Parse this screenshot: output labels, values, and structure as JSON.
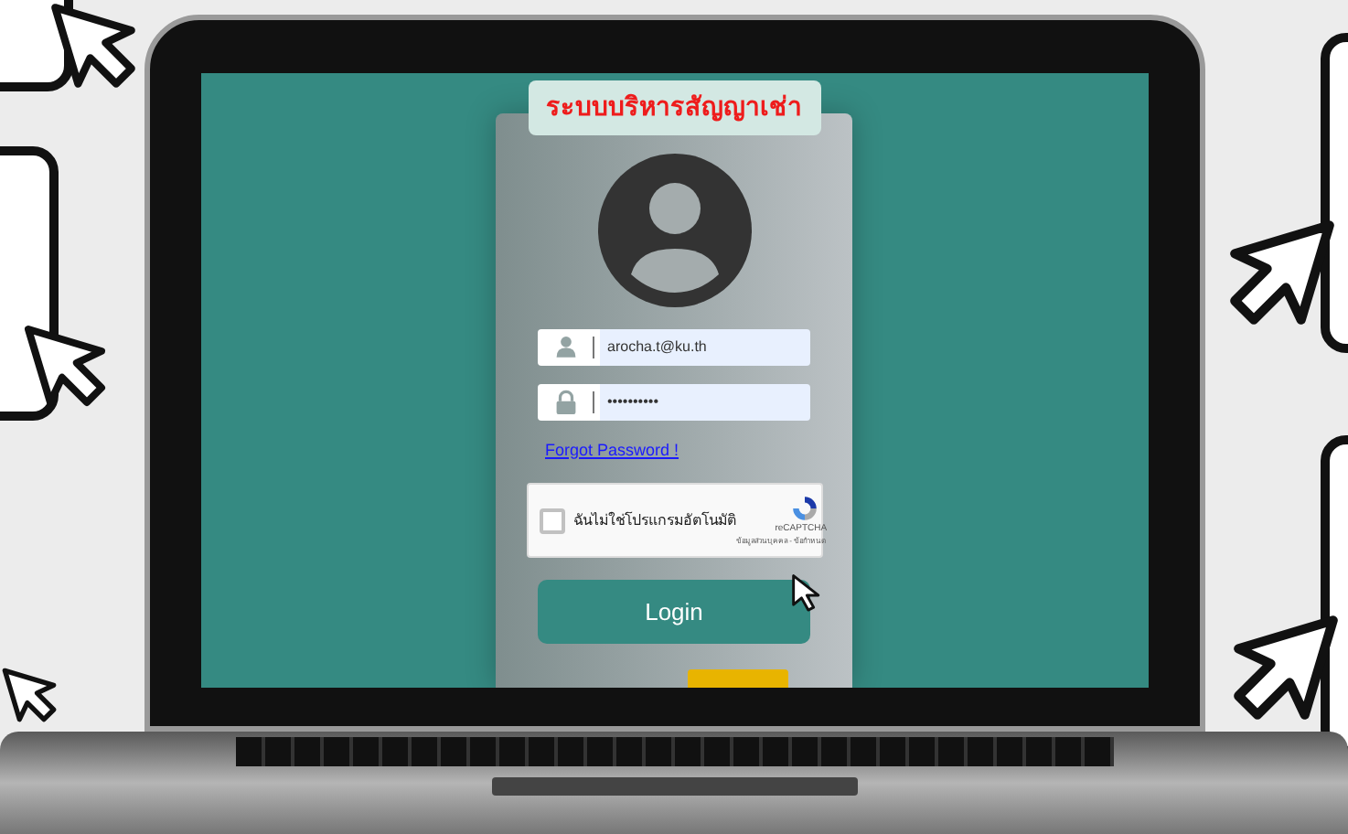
{
  "title": "ระบบบริหารสัญญาเช่า",
  "fields": [
    {
      "kind": "user",
      "value": "arocha.t@ku.th"
    },
    {
      "kind": "lock",
      "value": "••••••••••"
    }
  ],
  "forgot_link": "Forgot Password !",
  "captcha": {
    "label": "ฉันไม่ใช่โปรแกรมอัตโนมัติ",
    "checked": false,
    "brand": "reCAPTCHA",
    "terms": "ข้อมูลส่วนบุคคล - ข้อกำหนด"
  },
  "login_button": "Login"
}
